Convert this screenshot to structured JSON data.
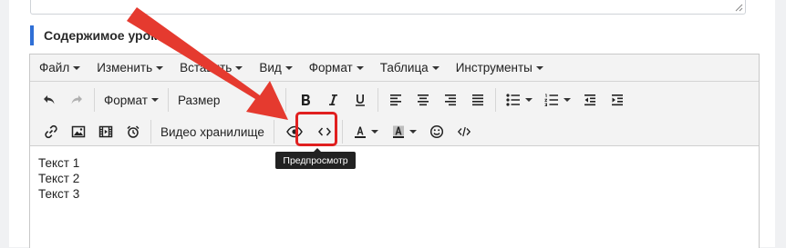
{
  "section": {
    "title": "Содержимое урока"
  },
  "menubar": {
    "items": [
      "Файл",
      "Изменить",
      "Вставить",
      "Вид",
      "Формат",
      "Таблица",
      "Инструменты"
    ]
  },
  "toolbar": {
    "format_label": "Формат",
    "size_label": "Размер",
    "video_storage_label": "Видео хранилище"
  },
  "tooltip": {
    "text": "Предпросмотр"
  },
  "content": {
    "lines": [
      "Текст 1",
      "Текст 2",
      "Текст 3"
    ]
  },
  "colors": {
    "accent": "#2f6fd6",
    "annotation_red": "#e53a2f",
    "highlight": "#e02020"
  }
}
